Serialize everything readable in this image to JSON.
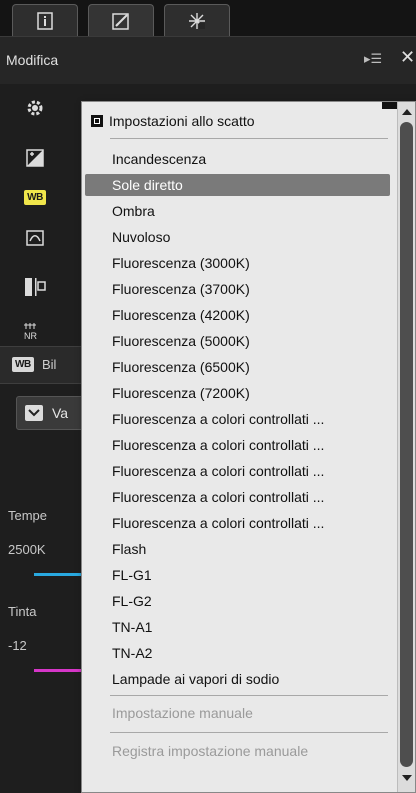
{
  "tabs": [
    {
      "name": "info-icon"
    },
    {
      "name": "edit-icon"
    },
    {
      "name": "sparkle-icon"
    }
  ],
  "panel": {
    "title": "Modifica",
    "menu_glyph": "▸☰",
    "close_glyph": "✕"
  },
  "section": {
    "badge": "WB",
    "label": "Bil"
  },
  "mode_select": {
    "value": "Va"
  },
  "background": {
    "temperature_label": "Tempe",
    "temperature_value": "2500K",
    "tint_label": "Tinta",
    "tint_value": "-12"
  },
  "colors": {
    "temperature_slider": "#29a9e0",
    "tint_slider": "#d636c8",
    "selected_item": "#7a7a7a",
    "wb_badge": "#f0e64b"
  },
  "menu": {
    "items": [
      {
        "label": "Impostazioni allo scatto",
        "checked": true
      },
      {
        "label": "Incandescenza"
      },
      {
        "label": "Sole diretto",
        "selected": true
      },
      {
        "label": "Ombra"
      },
      {
        "label": "Nuvoloso"
      },
      {
        "label": "Fluorescenza (3000K)"
      },
      {
        "label": "Fluorescenza (3700K)"
      },
      {
        "label": "Fluorescenza (4200K)"
      },
      {
        "label": "Fluorescenza (5000K)"
      },
      {
        "label": "Fluorescenza (6500K)"
      },
      {
        "label": "Fluorescenza (7200K)"
      },
      {
        "label": "Fluorescenza a colori controllati ..."
      },
      {
        "label": "Fluorescenza a colori controllati ..."
      },
      {
        "label": "Fluorescenza a colori controllati ..."
      },
      {
        "label": "Fluorescenza a colori controllati ..."
      },
      {
        "label": "Fluorescenza a colori controllati ..."
      },
      {
        "label": "Flash"
      },
      {
        "label": "FL-G1"
      },
      {
        "label": "FL-G2"
      },
      {
        "label": "TN-A1"
      },
      {
        "label": "TN-A2"
      },
      {
        "label": "Lampade ai vapori di sodio"
      },
      {
        "label": "Impostazione manuale",
        "disabled": true
      },
      {
        "label": "Registra impostazione manuale",
        "disabled": true
      }
    ]
  }
}
